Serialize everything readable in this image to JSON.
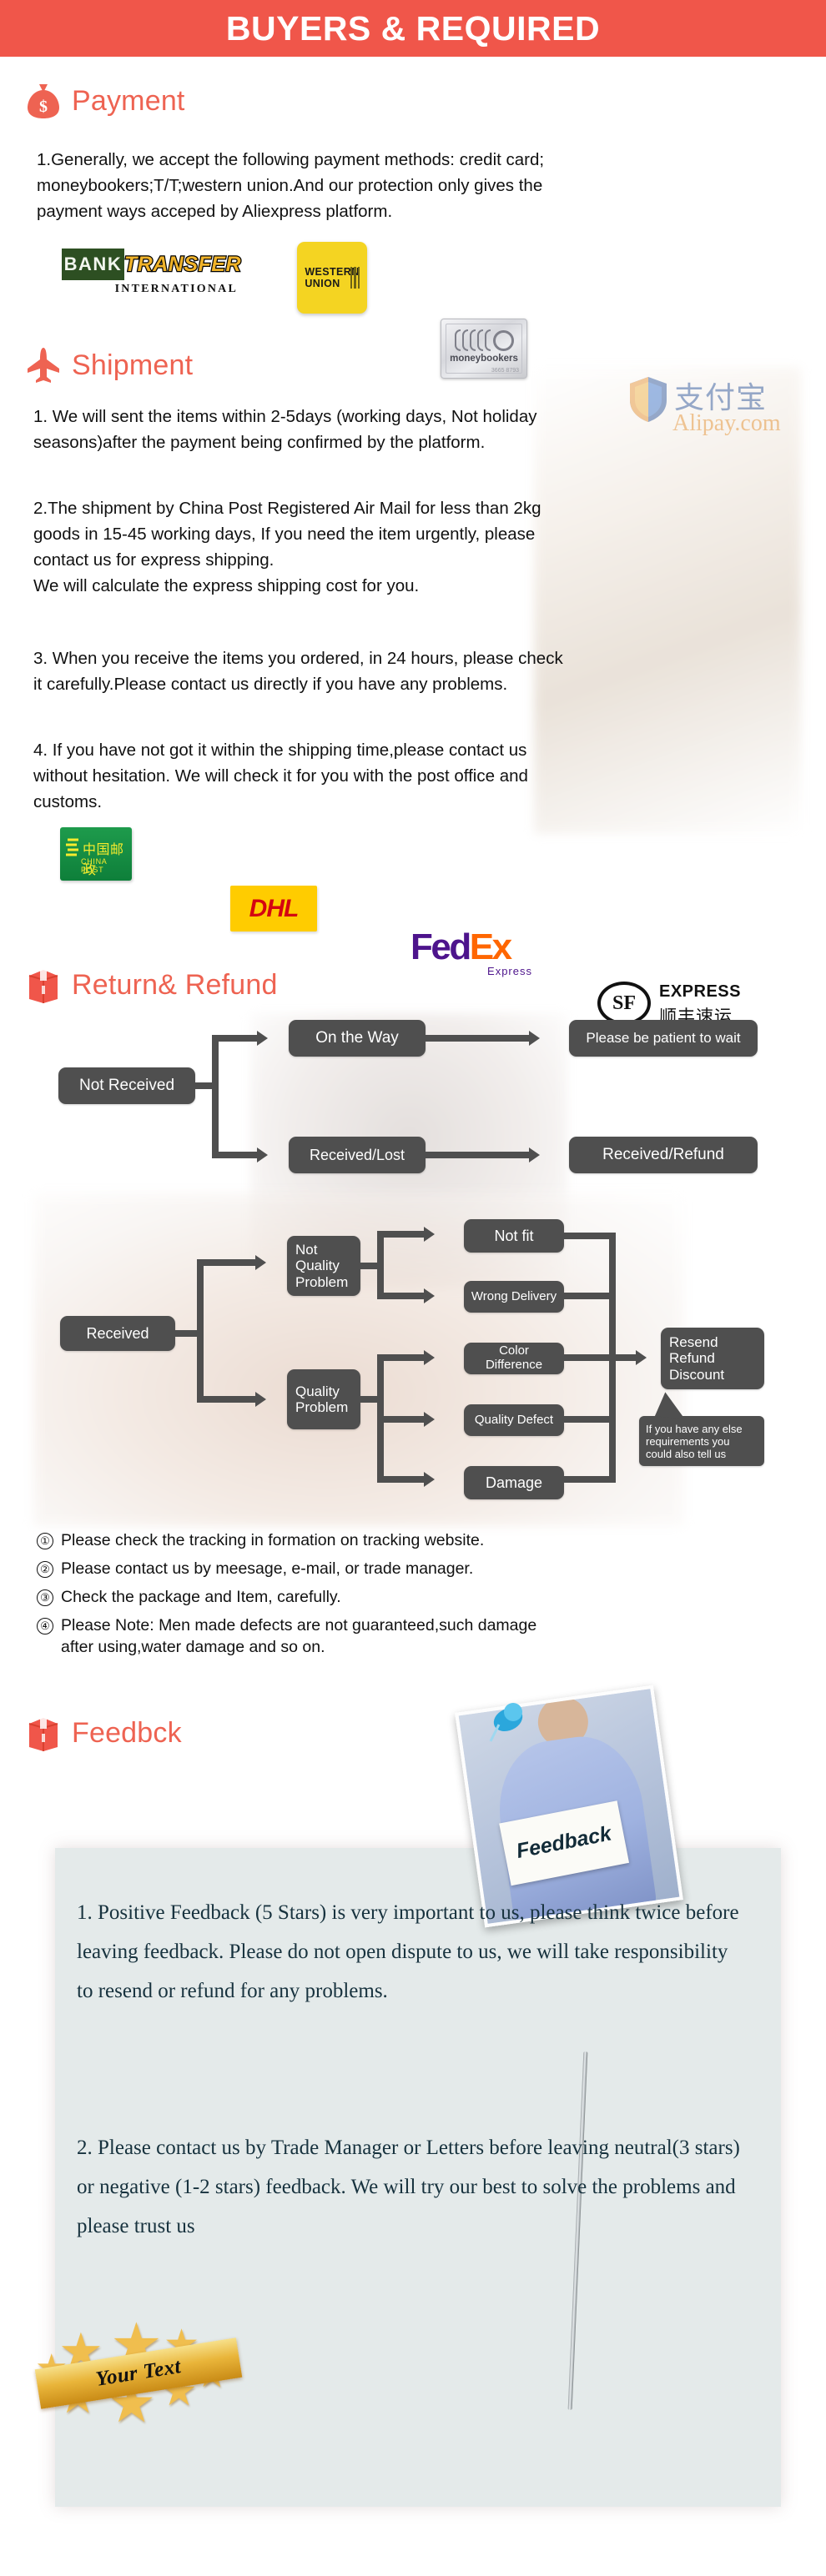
{
  "header": {
    "title": "BUYERS & REQUIRED"
  },
  "sections": {
    "payment": {
      "icon": "money-bag-icon",
      "title": "Payment",
      "body": "1.Generally, we accept the following payment methods: credit card;\nmoneybookers;T/T;western union.And our protection only gives the\npayment ways acceped by Aliexpress platform.",
      "logos": [
        {
          "name": "bank-transfer-logo",
          "bank": "BANK",
          "transfer": "TRANSFER",
          "international": "INTERNATIONAL"
        },
        {
          "name": "western-union-logo",
          "line1": "WESTERN",
          "line2": "UNION"
        },
        {
          "name": "moneybookers-logo",
          "label": "moneybookers",
          "micro": "3665 8793"
        },
        {
          "name": "alipay-logo",
          "chinese": "支付宝",
          "latin": "Alipay.com"
        }
      ]
    },
    "shipment": {
      "icon": "airplane-icon",
      "title": "Shipment",
      "para1": "1. We will sent the items within 2-5days (working days, Not holiday\nseasons)after the payment being confirmed by the platform.",
      "para2": "2.The shipment by China Post Registered Air Mail for less than  2kg\ngoods in 15-45 working days, If  you need the item urgently, please\ncontact us for express shipping.\nWe will calculate the express shipping cost for you.",
      "para3": "3. When you receive the items you ordered, in 24 hours, please check\n it carefully.Please contact us directly if you have any problems.",
      "para4": "4. If you have not got it within the shipping time,please contact us\nwithout hesitation. We will check it for you with the post office and\ncustoms.",
      "carriers": [
        {
          "name": "china-post-logo",
          "chinese": "中国邮政",
          "english": "CHINA POST"
        },
        {
          "name": "dhl-logo",
          "text": "DHL"
        },
        {
          "name": "fedex-logo",
          "fed": "Fed",
          "ex": "Ex",
          "sub": "Express"
        },
        {
          "name": "sf-express-logo",
          "mark": "SF",
          "english": "EXPRESS",
          "chinese": "顺丰速运"
        }
      ]
    },
    "return_refund": {
      "icon": "return-box-icon",
      "title": "Return& Refund",
      "flow_not_received": {
        "root": "Not Received",
        "branches": [
          {
            "from": "On the Way",
            "to": "Please be patient to wait"
          },
          {
            "from": "Received/Lost",
            "to": "Received/Refund"
          }
        ]
      },
      "flow_received": {
        "root": "Received",
        "groups": [
          {
            "label": "Not\nQuality\nProblem",
            "items": [
              "Not fit",
              "Wrong Delivery"
            ]
          },
          {
            "label": "Quality\nProblem",
            "items": [
              "Color Difference",
              "Quality Defect",
              "Damage"
            ]
          }
        ],
        "result": "Resend\nRefund\nDiscount",
        "callout": "If you have any else\nrequirements you\ncould also tell us"
      },
      "notes": [
        {
          "num": "①",
          "text": "Please check the tracking in formation on tracking website."
        },
        {
          "num": "②",
          "text": "Please contact us by meesage, e-mail, or trade manager."
        },
        {
          "num": "③",
          "text": "Check the package and Item, carefully."
        },
        {
          "num": "④",
          "text": "Please Note: Men made defects  are not guaranteed,such damage\nafter using,water damage and so on."
        }
      ]
    },
    "feedback": {
      "icon": "feedback-box-icon",
      "title": "Feedbck",
      "photo_sign_text": "Feedback",
      "pin_icon": "push-pin-icon",
      "para1": "1. Positive Feedback (5 Stars) is very important to us, please think twice before leaving feedback. Please do not open dispute to us,   we will take responsibility to resend or refund for any problems.",
      "para2": "2. Please contact us by Trade Manager or Letters before leaving neutral(3 stars) or negative (1-2 stars) feedback. We will try our best to solve the problems and please trust us",
      "badge": {
        "name": "gold-star-badge",
        "text": "Your Text"
      }
    }
  },
  "colors": {
    "header_bg": "#F0564A",
    "accent": "#EE6352",
    "node_bg": "#4F4F4F",
    "feedback_panel_bg": "#E4EAEA",
    "feedback_text": "#17323E"
  }
}
